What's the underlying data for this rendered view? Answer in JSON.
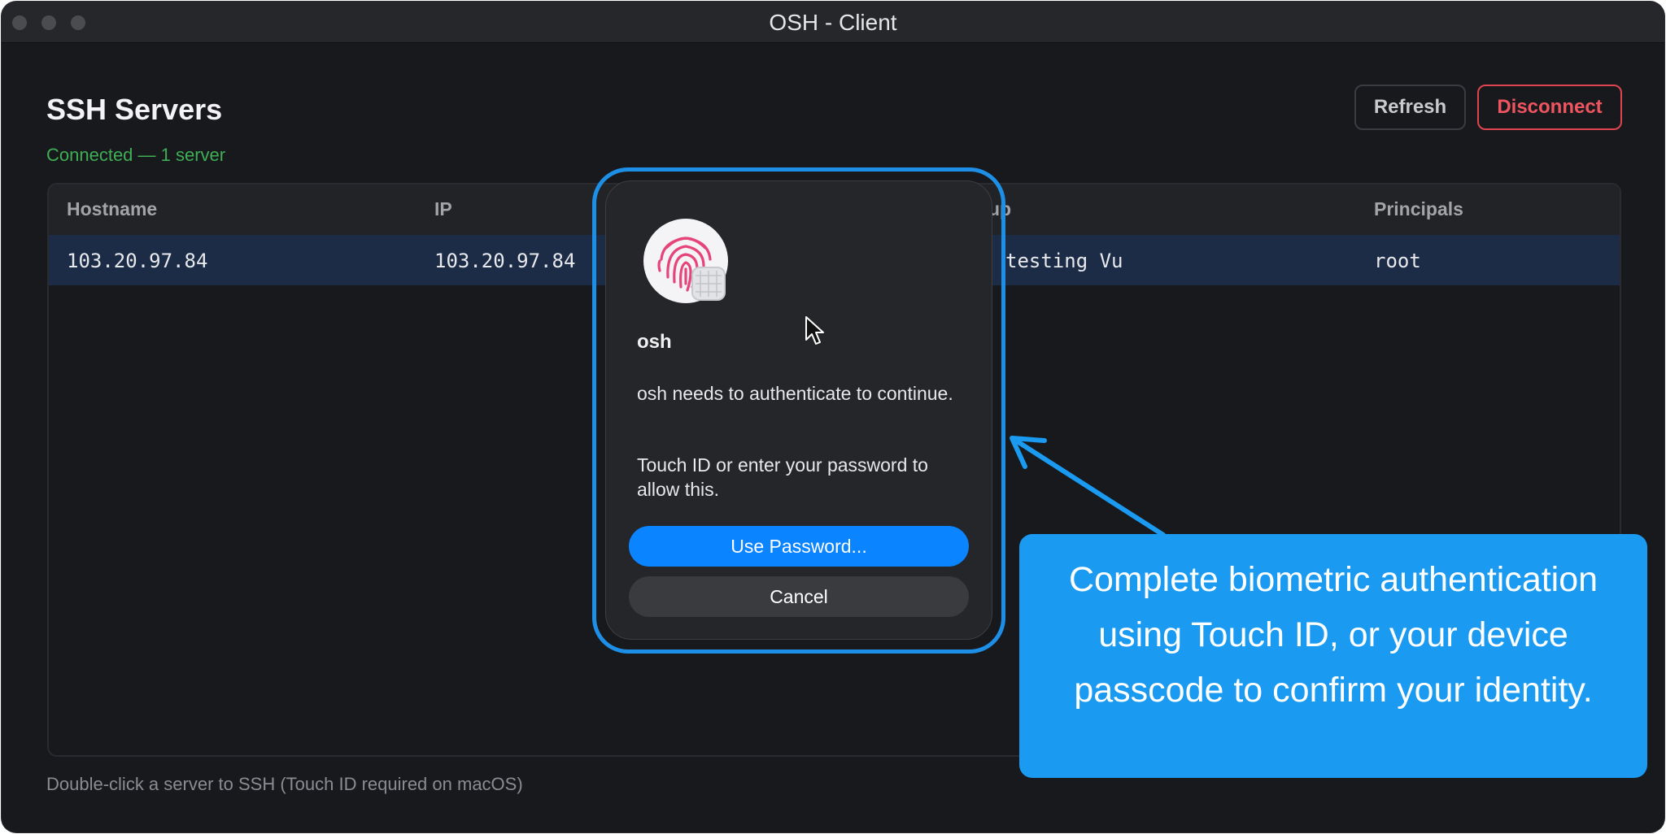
{
  "window": {
    "title": "OSH - Client"
  },
  "header": {
    "title": "SSH Servers",
    "status": "Connected — 1 server",
    "refresh_label": "Refresh",
    "disconnect_label": "Disconnect"
  },
  "table": {
    "columns": [
      "Hostname",
      "IP",
      "Principals"
    ],
    "partial_group_header": "up",
    "rows": [
      {
        "hostname": "103.20.97.84",
        "ip": "103.20.97.84",
        "group": "testing Vu",
        "principals": "root"
      }
    ]
  },
  "footer": {
    "hint": "Double-click a server to SSH (Touch ID required on macOS)"
  },
  "dialog": {
    "app_name": "osh",
    "message_line1": "osh needs to authenticate to continue.",
    "message_line2": "Touch ID or enter your password to allow this.",
    "use_password_label": "Use Password...",
    "cancel_label": "Cancel",
    "icon": "fingerprint-icon"
  },
  "callout": {
    "text": "Complete biometric authentication using Touch ID, or your device passcode to confirm your identity."
  },
  "colors": {
    "accent_blue": "#0a84ff",
    "connected_green": "#3fae55",
    "disconnect_red": "#ef5560",
    "callout_blue": "#1a9af1"
  }
}
